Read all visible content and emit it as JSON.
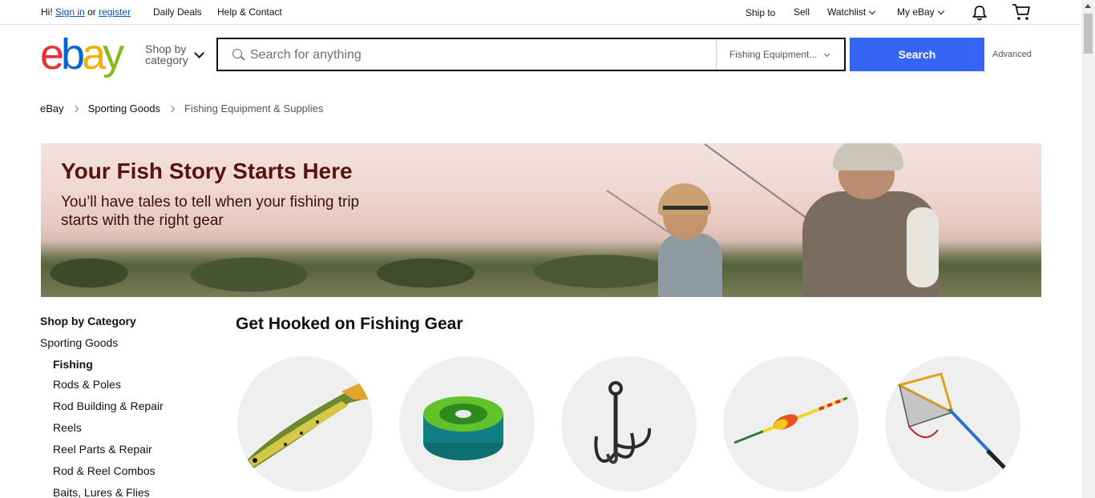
{
  "topbar": {
    "greeting": "Hi!",
    "sign_in": "Sign in",
    "or": "or",
    "register": "register",
    "daily_deals": "Daily Deals",
    "help_contact": "Help & Contact",
    "ship_to": "Ship to",
    "sell": "Sell",
    "watchlist": "Watchlist",
    "my_ebay": "My eBay",
    "notification_icon": "bell-icon",
    "cart_icon": "cart-icon"
  },
  "header": {
    "logo_letters": [
      "e",
      "b",
      "a",
      "y"
    ],
    "shop_by_category": [
      "Shop by",
      "category"
    ],
    "search_placeholder": "Search for anything",
    "category_select": "Fishing Equipment...",
    "search_button": "Search",
    "advanced": "Advanced"
  },
  "breadcrumb": [
    "eBay",
    "Sporting Goods",
    "Fishing Equipment & Supplies"
  ],
  "hero": {
    "title": "Your Fish Story Starts Here",
    "subtitle": "You’ll have tales to tell when your fishing trip starts with the right gear"
  },
  "sidebar": {
    "heading": "Shop by Category",
    "parent": "Sporting Goods",
    "current": "Fishing",
    "items": [
      "Rods & Poles",
      "Rod Building & Repair",
      "Reels",
      "Reel Parts & Repair",
      "Rod & Reel Combos",
      "Baits, Lures & Flies"
    ]
  },
  "main": {
    "title": "Get Hooked on Fishing Gear",
    "cards": [
      "lure-image",
      "fishing-line-image",
      "hook-image",
      "float-image",
      "landing-net-image"
    ]
  },
  "colors": {
    "accent": "#3665f3",
    "link": "#0654ba",
    "hero_title": "#5a1111"
  }
}
